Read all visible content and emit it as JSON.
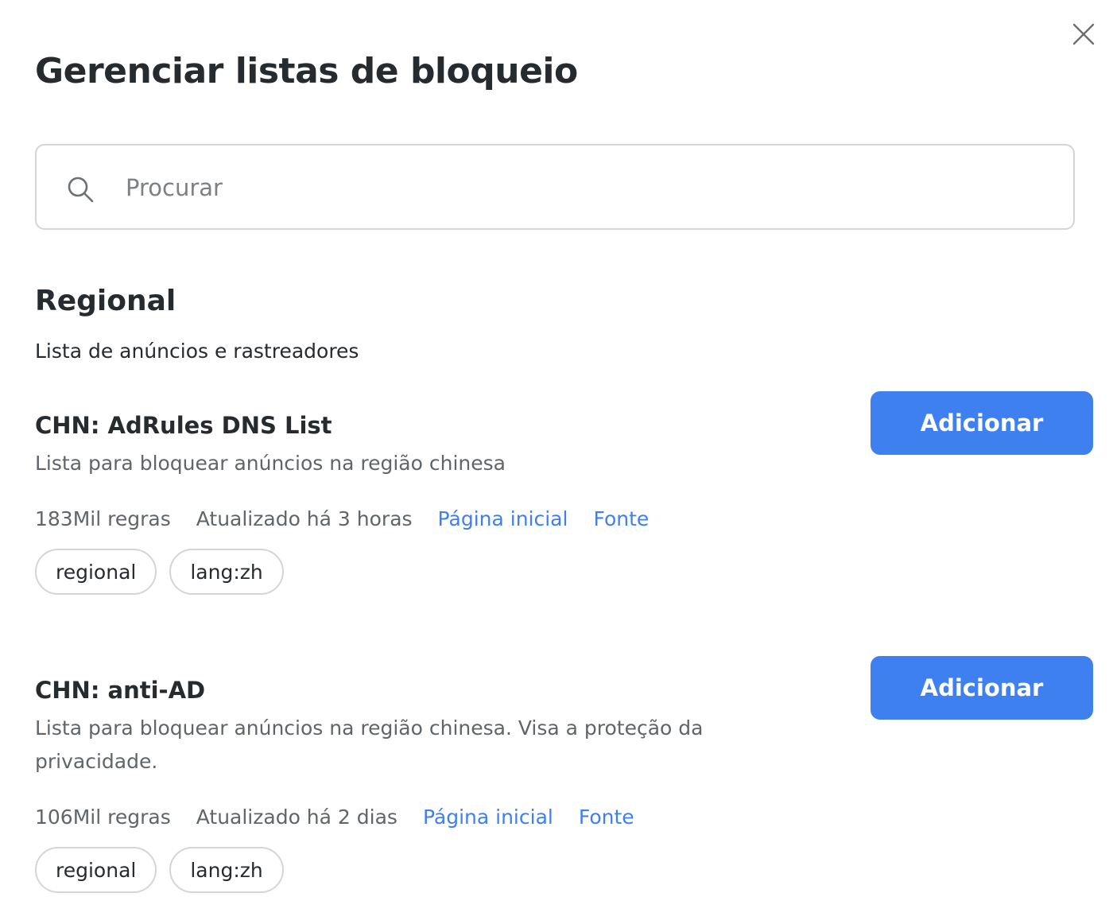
{
  "dialog": {
    "title": "Gerenciar listas de bloqueio",
    "close_icon": "close-icon"
  },
  "search": {
    "placeholder": "Procurar",
    "value": "",
    "icon": "search-icon"
  },
  "section": {
    "title": "Regional",
    "subtitle": "Lista de anúncios e rastreadores"
  },
  "colors": {
    "accent": "#3f80f0",
    "text": "#262b30",
    "muted": "#5f656b",
    "border": "#d4d5d7"
  },
  "items": [
    {
      "title": "CHN: AdRules DNS List",
      "description": "Lista para bloquear anúncios na região chinesa",
      "rules": "183Mil regras",
      "updated": "Atualizado há 3 horas",
      "homepage_label": "Página inicial",
      "source_label": "Fonte",
      "add_label": "Adicionar",
      "tags": [
        "regional",
        "lang:zh"
      ]
    },
    {
      "title": "CHN: anti-AD",
      "description": "Lista para bloquear anúncios na região chinesa. Visa a proteção da privacidade.",
      "rules": "106Mil regras",
      "updated": "Atualizado há 2 dias",
      "homepage_label": "Página inicial",
      "source_label": "Fonte",
      "add_label": "Adicionar",
      "tags": [
        "regional",
        "lang:zh"
      ]
    }
  ]
}
